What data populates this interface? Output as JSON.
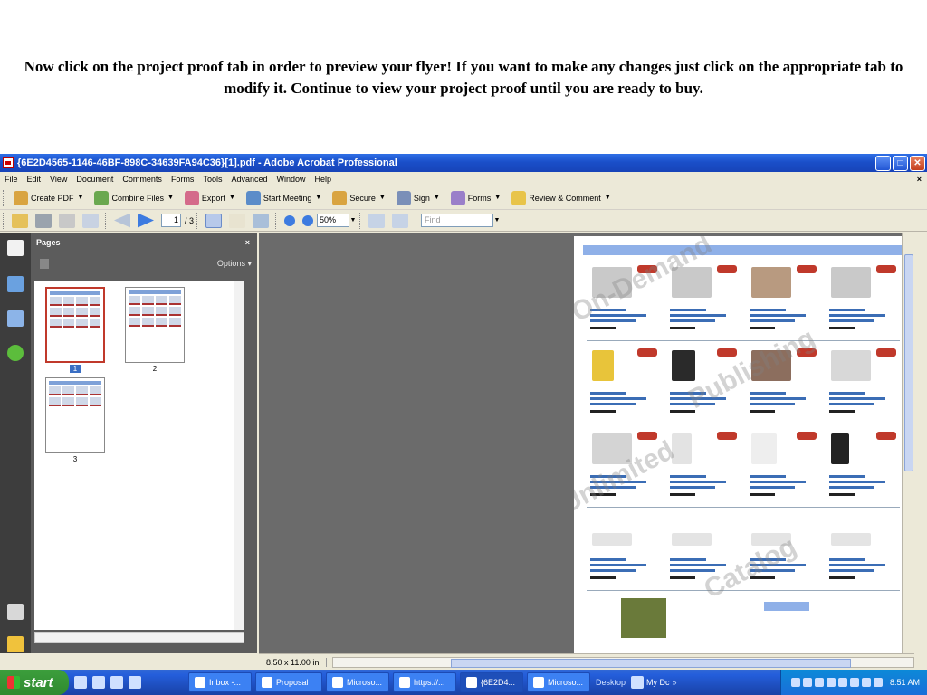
{
  "caption": "Now click on the project proof tab in order to preview your flyer! If you want to make any changes just click on the appropriate tab to modify it. Continue to view your project proof until you are ready to buy.",
  "window": {
    "title": "{6E2D4565-1146-46BF-898C-34639FA94C36}[1].pdf - Adobe Acrobat Professional",
    "minimize": "_",
    "maximize": "□",
    "close": "✕"
  },
  "menu": {
    "items": [
      "File",
      "Edit",
      "View",
      "Document",
      "Comments",
      "Forms",
      "Tools",
      "Advanced",
      "Window",
      "Help"
    ],
    "close": "×"
  },
  "toolbar": {
    "create_pdf": "Create PDF",
    "combine_files": "Combine Files",
    "export": "Export",
    "start_meeting": "Start Meeting",
    "secure": "Secure",
    "sign": "Sign",
    "forms": "Forms",
    "review_comment": "Review & Comment"
  },
  "nav": {
    "page_current": "1",
    "page_total": "/ 3",
    "zoom": "50%",
    "find_placeholder": "Find"
  },
  "pages_panel": {
    "title": "Pages",
    "close": "×",
    "options": "Options",
    "thumbs": [
      {
        "label": "1",
        "selected": true
      },
      {
        "label": "2",
        "selected": false
      },
      {
        "label": "3",
        "selected": false
      }
    ]
  },
  "status": {
    "page_size": "8.50 x 11.00 in"
  },
  "taskbar": {
    "start": "start",
    "tasks": [
      {
        "label": "Inbox -...",
        "active": false
      },
      {
        "label": "Proposal",
        "active": false
      },
      {
        "label": "Microso...",
        "active": false
      },
      {
        "label": "https://...",
        "active": false
      },
      {
        "label": "{6E2D4...",
        "active": true
      },
      {
        "label": "Microso...",
        "active": false
      }
    ],
    "desktop": "Desktop",
    "mydocs": "My Dc",
    "clock": "8:51 AM"
  },
  "colors": {
    "title_blue": "#1a4fc9",
    "start_green": "#3c9e3c",
    "thumb_selected": "#c0392b"
  }
}
